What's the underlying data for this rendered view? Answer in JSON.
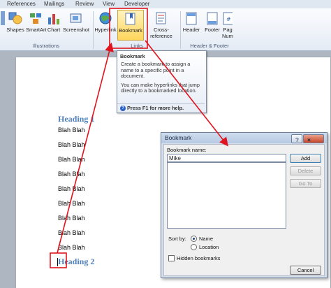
{
  "ribbon": {
    "tabs": [
      "References",
      "Mailings",
      "Review",
      "View",
      "Developer"
    ],
    "buttons": {
      "shapes": "Shapes",
      "smartart": "SmartArt",
      "chart": "Chart",
      "screenshot": "Screenshot",
      "hyperlink": "Hyperlink",
      "bookmark": "Bookmark",
      "cross_reference": "Cross-reference",
      "header": "Header",
      "footer": "Footer",
      "page_number_1": "Pag",
      "page_number_2": "Numb"
    },
    "groups": {
      "illustrations": "Illustrations",
      "links": "Links",
      "header_footer": "Header & Footer"
    }
  },
  "document": {
    "heading1": "Heading 1",
    "heading2": "Heading 2",
    "lines": [
      "Blah Blah",
      "Blah Blah",
      "Blah Blah",
      "Blah Blah",
      "Blah Blah",
      "Blah Blah",
      "Blah Blah",
      "Blah Blah",
      "Blah Blah"
    ]
  },
  "tooltip": {
    "title": "Bookmark",
    "p1": "Create a bookmark to assign a name to a specific point in a document.",
    "p2": "You can make hyperlinks that jump directly to a bookmarked location.",
    "help": "Press F1 for more help."
  },
  "dialog": {
    "title": "Bookmark",
    "help_glyph": "?",
    "close_glyph": "×",
    "name_label": "Bookmark name:",
    "name_value": "Mike",
    "add": "Add",
    "delete": "Delete",
    "goto": "Go To",
    "sort_by": "Sort by:",
    "sort_name": "Name",
    "sort_location": "Location",
    "hidden": "Hidden bookmarks",
    "cancel": "Cancel"
  },
  "colors": {
    "annotation": "#e0141e",
    "heading": "#4f81bd"
  }
}
